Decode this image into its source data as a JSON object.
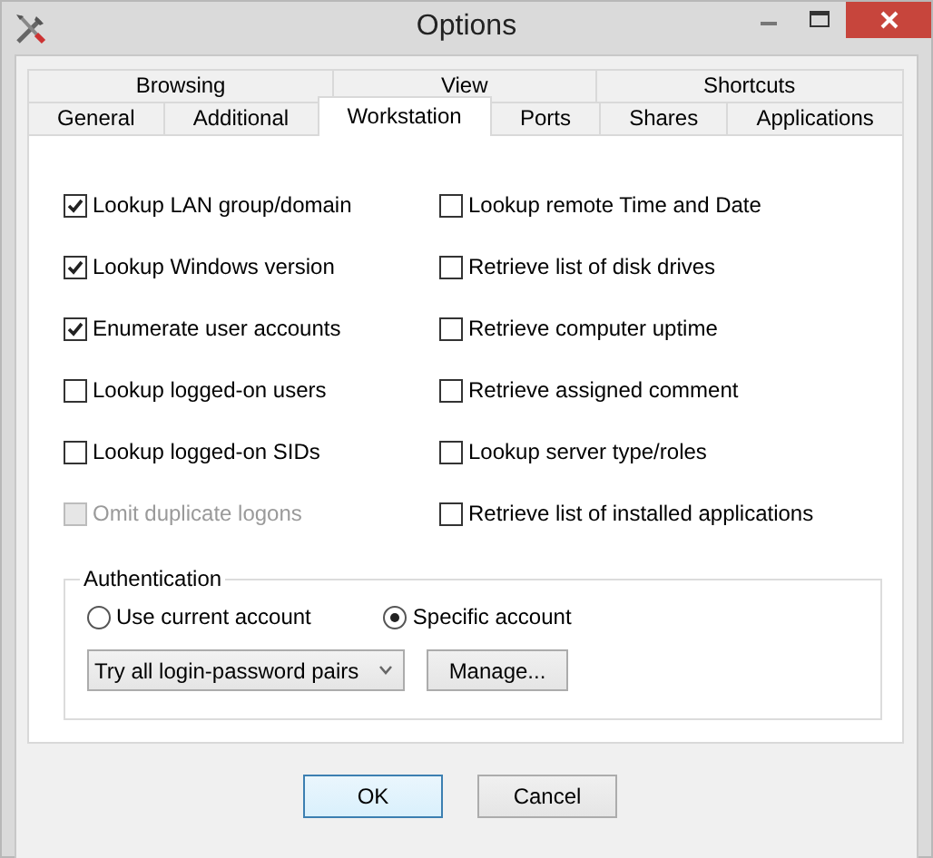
{
  "window": {
    "title": "Options"
  },
  "tab_rows": [
    {
      "tabs": [
        {
          "label": "Browsing",
          "selected": false
        },
        {
          "label": "View",
          "selected": false
        },
        {
          "label": "Shortcuts",
          "selected": false
        }
      ]
    },
    {
      "tabs": [
        {
          "label": "General",
          "selected": false
        },
        {
          "label": "Additional",
          "selected": false
        },
        {
          "label": "Workstation",
          "selected": true
        },
        {
          "label": "Ports",
          "selected": false
        },
        {
          "label": "Shares",
          "selected": false
        },
        {
          "label": "Applications",
          "selected": false
        }
      ]
    }
  ],
  "options": {
    "left": [
      {
        "label": "Lookup LAN group/domain",
        "checked": true,
        "disabled": false
      },
      {
        "label": "Lookup Windows version",
        "checked": true,
        "disabled": false
      },
      {
        "label": "Enumerate user accounts",
        "checked": true,
        "disabled": false
      },
      {
        "label": "Lookup logged-on users",
        "checked": false,
        "disabled": false
      },
      {
        "label": "Lookup logged-on SIDs",
        "checked": false,
        "disabled": false
      },
      {
        "label": "Omit duplicate logons",
        "checked": false,
        "disabled": true
      }
    ],
    "right": [
      {
        "label": "Lookup remote Time and Date",
        "checked": false,
        "disabled": false
      },
      {
        "label": "Retrieve list of disk drives",
        "checked": false,
        "disabled": false
      },
      {
        "label": "Retrieve computer uptime",
        "checked": false,
        "disabled": false
      },
      {
        "label": "Retrieve assigned comment",
        "checked": false,
        "disabled": false
      },
      {
        "label": "Lookup server type/roles",
        "checked": false,
        "disabled": false
      },
      {
        "label": "Retrieve list of installed applications",
        "checked": false,
        "disabled": false
      }
    ]
  },
  "authentication": {
    "title": "Authentication",
    "accounts": [
      {
        "label": "Use current account",
        "selected": false
      },
      {
        "label": "Specific account",
        "selected": true
      }
    ],
    "login_mode": {
      "value": "Try all login-password pairs"
    },
    "manage_button": "Manage..."
  },
  "buttons": [
    {
      "label": "OK",
      "default": true
    },
    {
      "label": "Cancel",
      "default": false
    }
  ]
}
